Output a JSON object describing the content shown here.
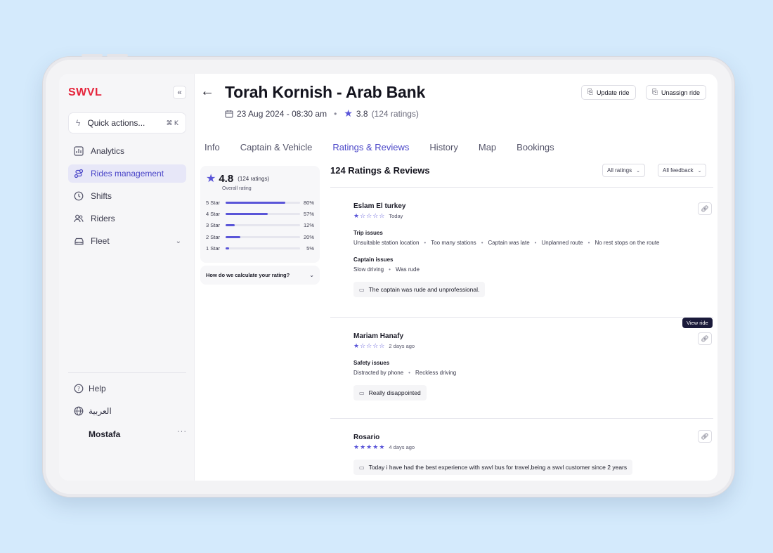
{
  "sidebar": {
    "logo": "SWVL",
    "collapse_label": "«",
    "quick_actions": {
      "label": "Quick actions...",
      "shortcut": "⌘ K"
    },
    "items": [
      {
        "label": "Analytics",
        "icon": "analytics-icon"
      },
      {
        "label": "Rides management",
        "icon": "route-icon",
        "active": true
      },
      {
        "label": "Shifts",
        "icon": "clock-icon"
      },
      {
        "label": "Riders",
        "icon": "users-icon"
      },
      {
        "label": "Fleet",
        "icon": "car-icon"
      }
    ],
    "help": "Help",
    "language": "العربية",
    "user": "Mostafa",
    "more": "···"
  },
  "header": {
    "back": "←",
    "title": "Torah Kornish - Arab Bank",
    "date": "23 Aug 2024 - 08:30 am",
    "rating": "3.8",
    "rating_count": "(124 ratings)",
    "update_ride": "Update ride",
    "unassign_ride": "Unassign ride"
  },
  "tabs": [
    "Info",
    "Captain & Vehicle",
    "Ratings & Reviews",
    "History",
    "Map",
    "Bookings"
  ],
  "active_tab": "Ratings & Reviews",
  "summary": {
    "score": "4.8",
    "count": "(124 ratings)",
    "caption": "Overall rating",
    "rows": [
      {
        "label": "5 Star",
        "percent": 80,
        "text": "80%"
      },
      {
        "label": "4 Star",
        "percent": 57,
        "text": "57%"
      },
      {
        "label": "3 Star",
        "percent": 12,
        "text": "12%"
      },
      {
        "label": "2 Star",
        "percent": 20,
        "text": "20%"
      },
      {
        "label": "1 Star",
        "percent": 5,
        "text": "5%"
      }
    ],
    "calc_question": "How do we calculate your rating?"
  },
  "reviews_panel": {
    "heading": "124 Ratings & Reviews",
    "filter_ratings": "All ratings",
    "filter_feedback": "All feedback",
    "view_ride_tooltip": "View ride"
  },
  "reviews": [
    {
      "name": "Eslam El turkey",
      "stars": 1,
      "ago": "Today",
      "sections": [
        {
          "title": "Trip issues",
          "items": [
            "Unsuitable station location",
            "Too many stations",
            "Captain was late",
            "Unplanned route",
            "No rest stops on the route"
          ]
        },
        {
          "title": "Captain issues",
          "items": [
            "Slow driving",
            "Was rude"
          ]
        }
      ],
      "comment": "The captain was rude and unprofessional."
    },
    {
      "name": "Mariam Hanafy",
      "stars": 1,
      "ago": "2 days ago",
      "sections": [
        {
          "title": "Safety issues",
          "items": [
            "Distracted by phone",
            "Reckless driving"
          ]
        }
      ],
      "comment": "Really disappointed"
    },
    {
      "name": "Rosario",
      "stars": 5,
      "ago": "4 days ago",
      "sections": [],
      "comment": "Today i have had the best experience with swvl bus for travel,being a swvl customer since 2 years"
    }
  ],
  "colors": {
    "accent": "#4b47c8",
    "star": "#5a55d8",
    "logo": "#e5243b",
    "background": "#d4eafc"
  }
}
